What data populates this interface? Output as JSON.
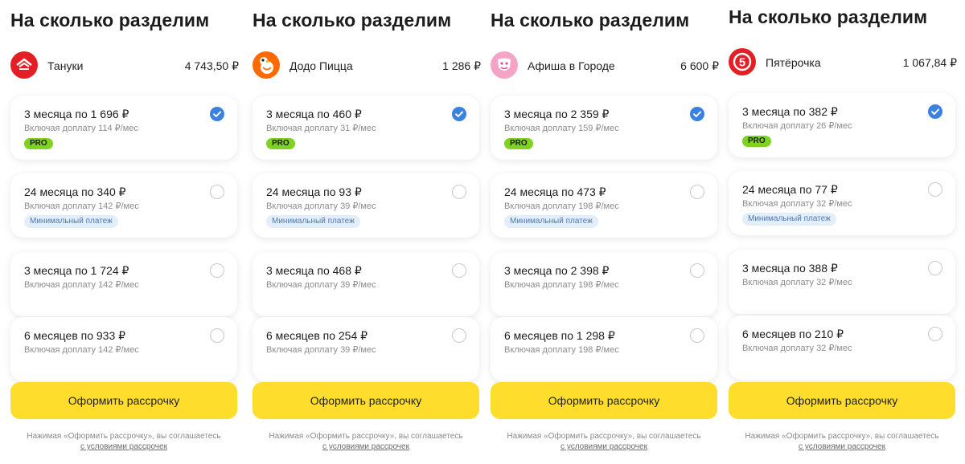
{
  "panels": [
    {
      "title": "На сколько разделим",
      "merchant": {
        "name": "Тануки",
        "amount": "4 743,50 ₽",
        "logo_icon": "tanuki-logo-icon",
        "logo_color": "#e31e24"
      },
      "options": [
        {
          "label": "3 месяца по 1 696 ₽",
          "sublabel": "Включая доплату 114 ₽/мес",
          "badge": "PRO",
          "badge_type": "pro",
          "selected": true
        },
        {
          "label": "24 месяца по 340 ₽",
          "sublabel": "Включая доплату 142 ₽/мес",
          "badge": "Минимальный платеж",
          "badge_type": "min",
          "selected": false
        },
        {
          "label": "3 месяца по 1 724 ₽",
          "sublabel": "Включая доплату 142 ₽/мес",
          "badge": "",
          "badge_type": "",
          "selected": false
        },
        {
          "label": "6 месяцев по 933 ₽",
          "sublabel": "Включая доплату 142 ₽/мес",
          "badge": "",
          "badge_type": "",
          "selected": false
        }
      ],
      "button": "Оформить рассрочку",
      "legal_text": "Нажимая «Оформить рассрочку», вы соглашаетесь",
      "legal_link": "с условиями рассрочек"
    },
    {
      "title": "На сколько разделим",
      "merchant": {
        "name": "Додо Пицца",
        "amount": "1 286 ₽",
        "logo_icon": "dodo-logo-icon",
        "logo_color": "#ff6900"
      },
      "options": [
        {
          "label": "3 месяца по 460 ₽",
          "sublabel": "Включая доплату 31 ₽/мес",
          "badge": "PRO",
          "badge_type": "pro",
          "selected": true
        },
        {
          "label": "24 месяца по 93 ₽",
          "sublabel": "Включая доплату 39 ₽/мес",
          "badge": "Минимальный платеж",
          "badge_type": "min",
          "selected": false
        },
        {
          "label": "3 месяца по 468 ₽",
          "sublabel": "Включая доплату 39 ₽/мес",
          "badge": "",
          "badge_type": "",
          "selected": false
        },
        {
          "label": "6 месяцев по 254 ₽",
          "sublabel": "Включая доплату 39 ₽/мес",
          "badge": "",
          "badge_type": "",
          "selected": false
        }
      ],
      "button": "Оформить рассрочку",
      "legal_text": "Нажимая «Оформить рассрочку», вы соглашаетесь",
      "legal_link": "с условиями рассрочек"
    },
    {
      "title": "На сколько разделим",
      "merchant": {
        "name": "Афиша в Городе",
        "amount": "6 600 ₽",
        "logo_icon": "afisha-logo-icon",
        "logo_color": "#f5a3c7"
      },
      "options": [
        {
          "label": "3 месяца по 2 359 ₽",
          "sublabel": "Включая доплату 159 ₽/мес",
          "badge": "PRO",
          "badge_type": "pro",
          "selected": true
        },
        {
          "label": "24 месяца по 473 ₽",
          "sublabel": "Включая доплату 198 ₽/мес",
          "badge": "Минимальный платеж",
          "badge_type": "min",
          "selected": false
        },
        {
          "label": "3 месяца по 2 398 ₽",
          "sublabel": "Включая доплату 198 ₽/мес",
          "badge": "",
          "badge_type": "",
          "selected": false
        },
        {
          "label": "6 месяцев по 1 298 ₽",
          "sublabel": "Включая доплату 198 ₽/мес",
          "badge": "",
          "badge_type": "",
          "selected": false
        }
      ],
      "button": "Оформить рассрочку",
      "legal_text": "Нажимая «Оформить рассрочку», вы соглашаетесь",
      "legal_link": "с условиями рассрочек"
    },
    {
      "title": "На сколько разделим",
      "merchant": {
        "name": "Пятёрочка",
        "amount": "1 067,84 ₽",
        "logo_icon": "pyaterochka-logo-icon",
        "logo_color": "#e31e24"
      },
      "options": [
        {
          "label": "3 месяца по 382 ₽",
          "sublabel": "Включая доплату 26 ₽/мес",
          "badge": "PRO",
          "badge_type": "pro",
          "selected": true
        },
        {
          "label": "24 месяца по 77 ₽",
          "sublabel": "Включая доплату 32 ₽/мес",
          "badge": "Минимальный платеж",
          "badge_type": "min",
          "selected": false
        },
        {
          "label": "3 месяца по 388 ₽",
          "sublabel": "Включая доплату 32 ₽/мес",
          "badge": "",
          "badge_type": "",
          "selected": false
        },
        {
          "label": "6 месяцев по 210 ₽",
          "sublabel": "Включая доплату 32 ₽/мес",
          "badge": "",
          "badge_type": "",
          "selected": false
        }
      ],
      "button": "Оформить рассрочку",
      "legal_text": "Нажимая «Оформить рассрочку», вы соглашаетесь",
      "legal_link": "с условиями рассрочек"
    }
  ],
  "colors": {
    "accent_yellow": "#fedd2c",
    "check_blue": "#3b82e0",
    "pro_green": "#7ed321",
    "min_badge_bg": "#e3eefb"
  }
}
